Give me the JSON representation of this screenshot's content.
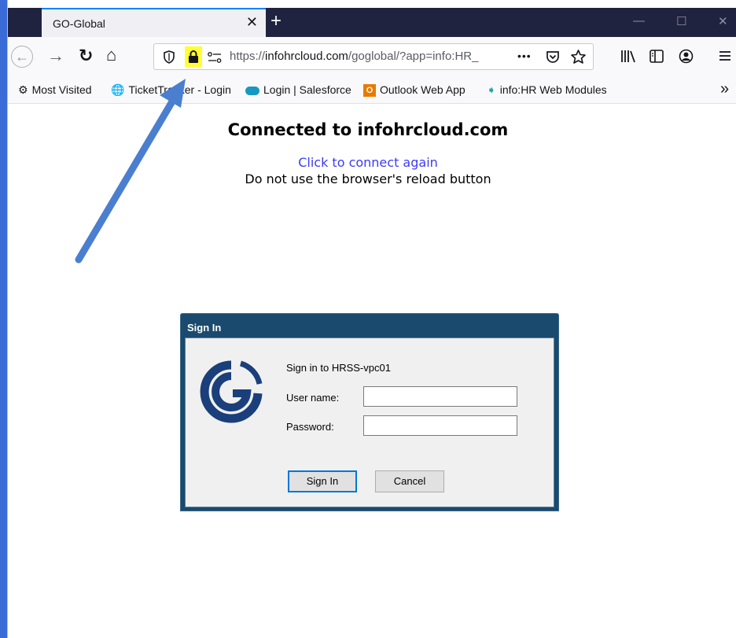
{
  "tab": {
    "title": "GO-Global",
    "close": "✕"
  },
  "new_tab": "+",
  "window_controls": {
    "minimize": "—",
    "maximize": "☐",
    "close": "✕"
  },
  "nav": {
    "back": "←",
    "forward": "→",
    "reload": "↻",
    "home": "⌂"
  },
  "url": {
    "prefix": "https://",
    "host": "infohrcloud.com",
    "path": "/goglobal/?app=info:HR_",
    "more": "•••"
  },
  "bookmarks": [
    {
      "icon": "gear-icon",
      "label": "Most Visited"
    },
    {
      "icon": "globe-icon",
      "label": "TicketTracker - Login"
    },
    {
      "icon": "salesforce-icon",
      "label": "Login | Salesforce"
    },
    {
      "icon": "outlook-icon",
      "label": "Outlook Web App"
    },
    {
      "icon": "infohr-icon",
      "label": "info:HR Web Modules"
    }
  ],
  "bookmarks_overflow": "»",
  "page": {
    "heading": "Connected to infohrcloud.com",
    "reconnect_link": "Click to connect again",
    "warning": "Do not use the browser's reload button"
  },
  "dialog": {
    "title": "Sign In",
    "prompt": "Sign in to HRSS-vpc01",
    "username_label": "User name:",
    "password_label": "Password:",
    "username_value": "",
    "password_value": "",
    "signin_label": "Sign In",
    "cancel_label": "Cancel"
  },
  "colors": {
    "arrow": "#4a7fd0",
    "lock_highlight": "#ffff33",
    "logo": "#1a3f7a"
  }
}
